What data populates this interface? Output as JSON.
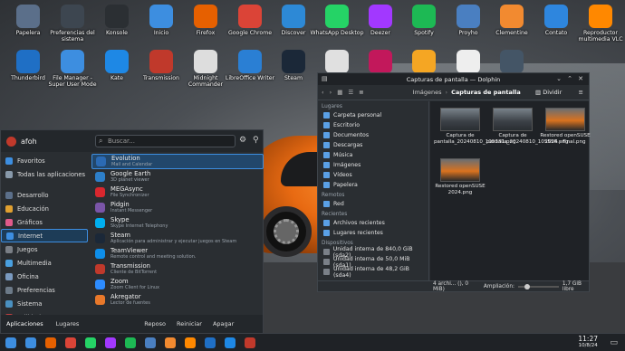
{
  "desktop_icons": [
    {
      "label": "Papelera",
      "icon": "trash-icon",
      "color": "#5b6f8a"
    },
    {
      "label": "Preferencias del sistema",
      "icon": "settings-icon",
      "color": "#3d4650"
    },
    {
      "label": "Konsole",
      "icon": "terminal-icon",
      "color": "#2b2f33"
    },
    {
      "label": "Inicio",
      "icon": "home-folder-icon",
      "color": "#3d8ee0"
    },
    {
      "label": "Firefox",
      "icon": "firefox-icon",
      "color": "#e66000"
    },
    {
      "label": "Google Chrome",
      "icon": "chrome-icon",
      "color": "#db4437"
    },
    {
      "label": "Discover",
      "icon": "discover-icon",
      "color": "#2d89d6"
    },
    {
      "label": "WhatsApp Desktop",
      "icon": "whatsapp-icon",
      "color": "#25d366"
    },
    {
      "label": "Deezer",
      "icon": "deezer-icon",
      "color": "#a238ff"
    },
    {
      "label": "Spotify",
      "icon": "spotify-icon",
      "color": "#1db954"
    },
    {
      "label": "Proyho",
      "icon": "proyho-icon",
      "color": "#4a7fc1"
    },
    {
      "label": "Clementine",
      "icon": "clementine-icon",
      "color": "#f28a30"
    },
    {
      "label": "Contato",
      "icon": "contacts-icon",
      "color": "#2e86de"
    },
    {
      "label": "Reproductor multimedia VLC",
      "icon": "vlc-icon",
      "color": "#ff8800"
    },
    {
      "label": "Thunderbird",
      "icon": "thunderbird-icon",
      "color": "#1f6fc5"
    },
    {
      "label": "File Manager - Super User Mode",
      "icon": "file-manager-icon",
      "color": "#3d8ee0"
    },
    {
      "label": "Kate",
      "icon": "kate-icon",
      "color": "#1e88e5"
    },
    {
      "label": "Transmission",
      "icon": "transmission-icon",
      "color": "#c0392b"
    },
    {
      "label": "Midnight Commander",
      "icon": "mc-icon",
      "color": "#dddddd"
    },
    {
      "label": "LibreOffice Writer",
      "icon": "writer-icon",
      "color": "#2a7fd4"
    },
    {
      "label": "Steam",
      "icon": "steam-icon",
      "color": "#1b2838"
    },
    {
      "label": "",
      "icon": "gamepad-icon",
      "color": "#e0e0e0"
    },
    {
      "label": "",
      "icon": "pcsx2-icon",
      "color": "#c2185b"
    },
    {
      "label": "",
      "icon": "update-icon",
      "color": "#f5a623"
    },
    {
      "label": "",
      "icon": "cleaner-icon",
      "color": "#eeeeee"
    },
    {
      "label": "",
      "icon": "gauge-icon",
      "color": "#445566"
    }
  ],
  "launcher": {
    "user": "afoh",
    "search_placeholder": "Buscar...",
    "categories": [
      {
        "label": "Favoritos",
        "color": "#3d8ee0"
      },
      {
        "label": "Todas las aplicaciones",
        "color": "#8899aa"
      },
      {
        "label": "Desarrollo",
        "color": "#5b6f8a"
      },
      {
        "label": "Educación",
        "color": "#e0a030"
      },
      {
        "label": "Gráficos",
        "color": "#e05a8a"
      },
      {
        "label": "Internet",
        "color": "#3d8ee0",
        "active": true
      },
      {
        "label": "Juegos",
        "color": "#7a7f86"
      },
      {
        "label": "Multimedia",
        "color": "#4aa0e0"
      },
      {
        "label": "Oficina",
        "color": "#7a9ac0"
      },
      {
        "label": "Preferencias",
        "color": "#6c7a88"
      },
      {
        "label": "Sistema",
        "color": "#4a90c0"
      },
      {
        "label": "Utilidades",
        "color": "#c04040"
      }
    ],
    "apps": [
      {
        "name": "Evolution",
        "desc": "Mail and Calendar",
        "color": "#2b6ab3"
      },
      {
        "name": "Google Earth",
        "desc": "3D planet viewer",
        "color": "#2d7fc9"
      },
      {
        "name": "MEGAsync",
        "desc": "File Synchronizer",
        "color": "#d9272e"
      },
      {
        "name": "Pidgin",
        "desc": "Instant Messenger",
        "color": "#7a55a8"
      },
      {
        "name": "Skype",
        "desc": "Skype Internet Telephony",
        "color": "#00aff0"
      },
      {
        "name": "Steam",
        "desc": "Aplicación para administrar y ejecutar juegos en Steam",
        "color": "#1b2838"
      },
      {
        "name": "TeamViewer",
        "desc": "Remote control and meeting solution.",
        "color": "#0e8ee9"
      },
      {
        "name": "Transmission",
        "desc": "Cliente de BitTorrent",
        "color": "#c0392b"
      },
      {
        "name": "Zoom",
        "desc": "Zoom Client for Linux",
        "color": "#2d8cff"
      },
      {
        "name": "Akregator",
        "desc": "Lector de fuentes",
        "color": "#e8782a"
      }
    ],
    "footer": {
      "applications": "Aplicaciones",
      "places": "Lugares",
      "sleep": "Reposo",
      "restart": "Reiniciar",
      "shutdown": "Apagar"
    }
  },
  "dolphin": {
    "title": "Capturas de pantalla — Dolphin",
    "breadcrumb_parent": "Imágenes",
    "breadcrumb_current": "Capturas de pantalla",
    "split_label": "Dividir",
    "places_sections": [
      {
        "title": "Lugares",
        "items": [
          "Carpeta personal",
          "Escritorio",
          "Documentos",
          "Descargas",
          "Música",
          "Imágenes",
          "Vídeos",
          "Papelera"
        ]
      },
      {
        "title": "Remotos",
        "items": [
          "Red"
        ]
      },
      {
        "title": "Recientes",
        "items": [
          "Archivos recientes",
          "Lugares recientes"
        ]
      },
      {
        "title": "Dispositivos",
        "items": [
          "Unidad interna de 840,0 GiB (sda2)",
          "Unidad interna de 50,0 MiB (sda1)",
          "Unidad interna de 48,2 GiB (sda4)"
        ]
      }
    ],
    "files": [
      {
        "name": "Captura de pantalla_20240810_105331.png",
        "kind": "screen"
      },
      {
        "name": "Captura de pantalla_20240810_105556.png",
        "kind": "screen"
      },
      {
        "name": "Restored openSUSE 2024 - Final.png",
        "kind": "car"
      },
      {
        "name": "Restored openSUSE 2024.png",
        "kind": "car"
      }
    ],
    "status_left": "4 archi... (), 0 MiB)",
    "zoom_label": "Ampliación:",
    "zoom_level": 0.15,
    "free_space": "1,7 GiB libre"
  },
  "taskbar": {
    "time": "11:27",
    "date": "10/8/24",
    "pinned": [
      {
        "icon": "menu-icon",
        "color": "#3d8ee0"
      },
      {
        "icon": "dolphin-icon",
        "color": "#3d8ee0"
      },
      {
        "icon": "firefox-icon",
        "color": "#e66000"
      },
      {
        "icon": "chrome-icon",
        "color": "#db4437"
      },
      {
        "icon": "whatsapp-icon",
        "color": "#25d366"
      },
      {
        "icon": "deezer-icon",
        "color": "#a238ff"
      },
      {
        "icon": "spotify-icon",
        "color": "#1db954"
      },
      {
        "icon": "proyho-icon",
        "color": "#4a7fc1"
      },
      {
        "icon": "clementine-icon",
        "color": "#f28a30"
      },
      {
        "icon": "vlc-icon",
        "color": "#ff8800"
      },
      {
        "icon": "thunderbird-icon",
        "color": "#1f6fc5"
      },
      {
        "icon": "kate-icon",
        "color": "#1e88e5"
      },
      {
        "icon": "transmission-icon",
        "color": "#c0392b"
      }
    ]
  }
}
